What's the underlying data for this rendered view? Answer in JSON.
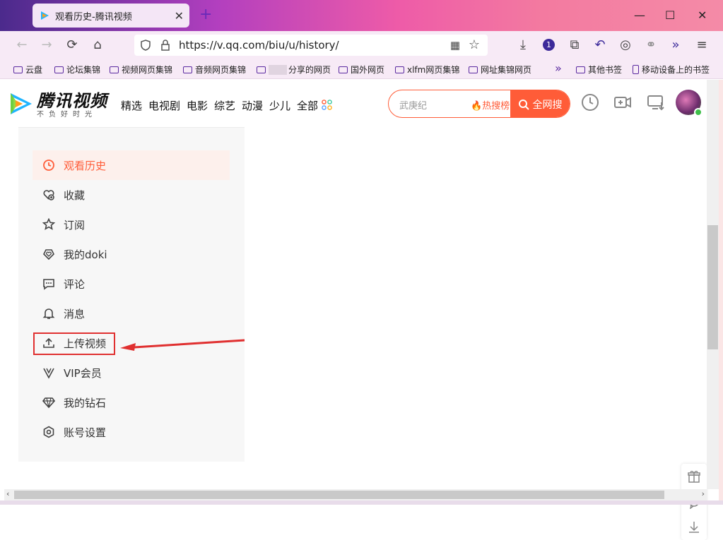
{
  "browser": {
    "tab_title": "观看历史-腾讯视频",
    "url": "https://v.qq.com/biu/u/history/",
    "badge_count": "1"
  },
  "bookmarks": [
    {
      "label": "云盘",
      "type": "folder"
    },
    {
      "label": "论坛集锦",
      "type": "folder"
    },
    {
      "label": "视频网页集锦",
      "type": "folder"
    },
    {
      "label": "音频网页集锦",
      "type": "folder"
    },
    {
      "label": "分享的网页",
      "type": "folder"
    },
    {
      "label": "国外网页",
      "type": "folder"
    },
    {
      "label": "xlfm网页集锦",
      "type": "folder"
    },
    {
      "label": "网址集锦网页",
      "type": "folder"
    },
    {
      "label": "其他书签",
      "type": "folder"
    },
    {
      "label": "移动设备上的书签",
      "type": "phone"
    }
  ],
  "site": {
    "logo_text": "腾讯视频",
    "logo_sub": "不负好时光",
    "nav": [
      "精选",
      "电视剧",
      "电影",
      "综艺",
      "动漫",
      "少儿",
      "全部"
    ],
    "search_placeholder": "武庚纪",
    "hot_label": "热搜榜",
    "search_button": "全网搜"
  },
  "sidebar": {
    "items": [
      {
        "label": "观看历史",
        "icon": "clock-icon",
        "active": true
      },
      {
        "label": "收藏",
        "icon": "heart-plus-icon"
      },
      {
        "label": "订阅",
        "icon": "star-icon"
      },
      {
        "label": "我的doki",
        "icon": "heart-diamond-icon"
      },
      {
        "label": "评论",
        "icon": "comment-icon"
      },
      {
        "label": "消息",
        "icon": "bell-icon"
      },
      {
        "label": "上传视频",
        "icon": "upload-icon"
      },
      {
        "label": "VIP会员",
        "icon": "vip-icon"
      },
      {
        "label": "我的钻石",
        "icon": "diamond-icon"
      },
      {
        "label": "账号设置",
        "icon": "settings-icon"
      }
    ]
  },
  "colors": {
    "accent": "#ff5c38",
    "annotation": "#e03030"
  }
}
